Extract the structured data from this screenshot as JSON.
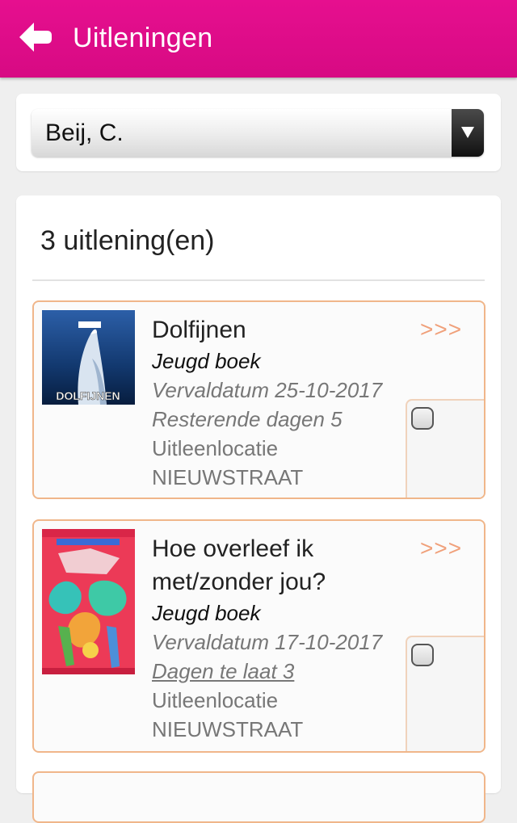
{
  "header": {
    "title": "Uitleningen",
    "back_icon": "back-arrow-icon"
  },
  "member_select": {
    "selected": "Beij, C."
  },
  "loans": {
    "count_label": "3 uitlening(en)",
    "more_label": ">>>",
    "items": [
      {
        "title": "Dolfijnen",
        "type": "Jeugd boek",
        "due": "Vervaldatum 25-10-2017",
        "status": "Resterende dagen 5",
        "location_label": "Uitleenlocatie",
        "location": "NIEUWSTRAAT",
        "cover_text": "DOLFIJNEN",
        "checked": false
      },
      {
        "title": "Hoe overleef ik met/zonder jou?",
        "type": "Jeugd boek",
        "due": "Vervaldatum 17-10-2017",
        "status": "Dagen te laat 3",
        "location_label": "Uitleenlocatie",
        "location": "NIEUWSTRAAT",
        "checked": false
      }
    ]
  },
  "colors": {
    "header": "#e60f8f",
    "item_border": "#f0b68a",
    "more_link": "#f0a07a"
  }
}
